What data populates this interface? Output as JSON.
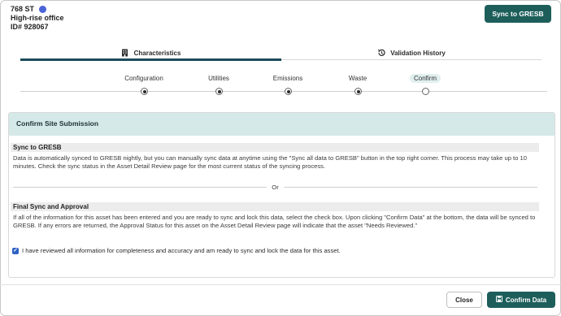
{
  "header": {
    "asset_name": "768 ST",
    "asset_type": "High-rise office",
    "asset_id": "ID# 928067",
    "status_color": "#4a63d8",
    "sync_button": "Sync to GRESB"
  },
  "tabs": [
    {
      "label": "Characteristics",
      "icon": "building-icon",
      "active": true
    },
    {
      "label": "Validation History",
      "icon": "history-icon",
      "active": false
    }
  ],
  "stepper": {
    "steps": [
      {
        "label": "Configuration",
        "state": "done"
      },
      {
        "label": "Utilities",
        "state": "done"
      },
      {
        "label": "Emissions",
        "state": "done"
      },
      {
        "label": "Waste",
        "state": "done"
      },
      {
        "label": "Confirm",
        "state": "current"
      }
    ]
  },
  "card": {
    "title": "Confirm Site Submission",
    "sync_section": {
      "title": "Sync to GRESB",
      "body": "Data is automatically synced to GRESB nightly, but you can manually sync data at anytime using the \"Sync all data to GRESB\" button in the top right corner. This process may take up to 10 minutes. Check the sync status in the Asset Detail Review page for the most current status of the syncing process."
    },
    "or_label": "Or",
    "final_section": {
      "title": "Final Sync and Approval",
      "body": "If all of the information for this asset has been entered and you are ready to sync and lock this data, select the check box. Upon clicking \"Confirm Data\" at the bottom, the data will be synced to GRESB. If any errors are returned, the Approval Status for this asset on the Asset Detail Review page will indicate that the asset \"Needs Reviewed.\""
    },
    "checkbox": {
      "checked": true,
      "label": "I have reviewed all information for completeness and accuracy and am ready to sync and lock the data for this asset."
    }
  },
  "footer": {
    "close_label": "Close",
    "confirm_label": "Confirm Data"
  },
  "colors": {
    "primary": "#1d5e5b",
    "header_band": "#d6e9e9",
    "tab_underline": "#1b4a5a",
    "checkbox": "#2f62c4"
  }
}
